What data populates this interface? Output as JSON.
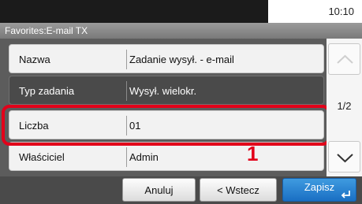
{
  "status": {
    "time": "10:10"
  },
  "title": "Favorites:E-mail TX",
  "rows": [
    {
      "label": "Nazwa",
      "value": "Zadanie wysył. - e-mail"
    },
    {
      "label": "Typ zadania",
      "value": "Wysył. wielokr."
    },
    {
      "label": "Liczba",
      "value": "01"
    },
    {
      "label": "Właściciel",
      "value": "Admin"
    }
  ],
  "pager": {
    "page": "1/2"
  },
  "callout": "1",
  "footer": {
    "cancel": "Anuluj",
    "back": "< Wstecz",
    "save": "Zapisz"
  },
  "colors": {
    "highlight": "#e2001a",
    "save": "#2a86d4"
  },
  "icons": {
    "up": "chevron-up-icon",
    "down": "chevron-down-icon",
    "enter": "enter-icon"
  }
}
